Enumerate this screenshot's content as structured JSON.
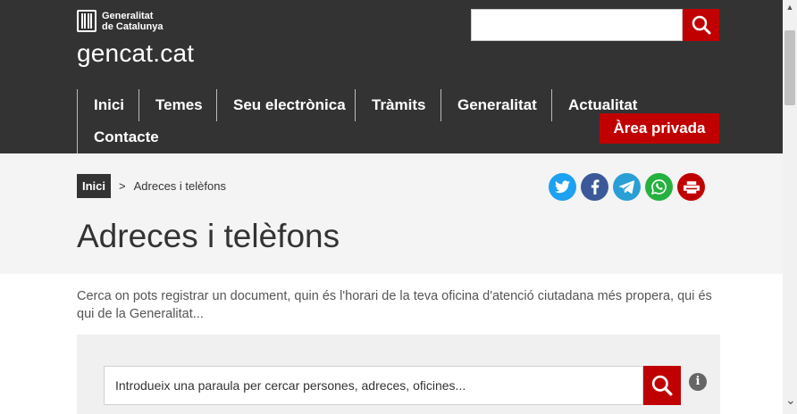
{
  "header": {
    "logo_line1": "Generalitat",
    "logo_line2": "de Catalunya",
    "site_title": "gencat.cat",
    "search_placeholder": "",
    "search_icon": "search-icon"
  },
  "nav": {
    "items": [
      {
        "label": "Inici"
      },
      {
        "label": "Temes"
      },
      {
        "label": "Seu electrònica"
      },
      {
        "label": "Tràmits"
      },
      {
        "label": "Generalitat"
      },
      {
        "label": "Actualitat"
      },
      {
        "label": "Contacte"
      }
    ],
    "area_privada": "Àrea privada"
  },
  "breadcrumb": {
    "home": "Inici",
    "separator": ">",
    "current": "Adreces i telèfons"
  },
  "share": [
    {
      "name": "twitter-icon",
      "color": "#1da1f2"
    },
    {
      "name": "facebook-icon",
      "color": "#3b5998"
    },
    {
      "name": "telegram-icon",
      "color": "#2a9fd6"
    },
    {
      "name": "whatsapp-icon",
      "color": "#25b13f"
    },
    {
      "name": "print-icon",
      "color": "#c00000"
    }
  ],
  "page": {
    "title": "Adreces i telèfons",
    "intro": "Cerca on pots registrar un document, quin és l'horari de la teva oficina d'atenció ciutadana més propera, qui és qui de la Generalitat..."
  },
  "main_search": {
    "placeholder": "Introdueix una paraula per cercar persones, adreces, oficines...",
    "info_label": "i"
  },
  "colors": {
    "header_bg": "#333333",
    "accent_red": "#c00000",
    "band_bg": "#f4f4f4"
  }
}
